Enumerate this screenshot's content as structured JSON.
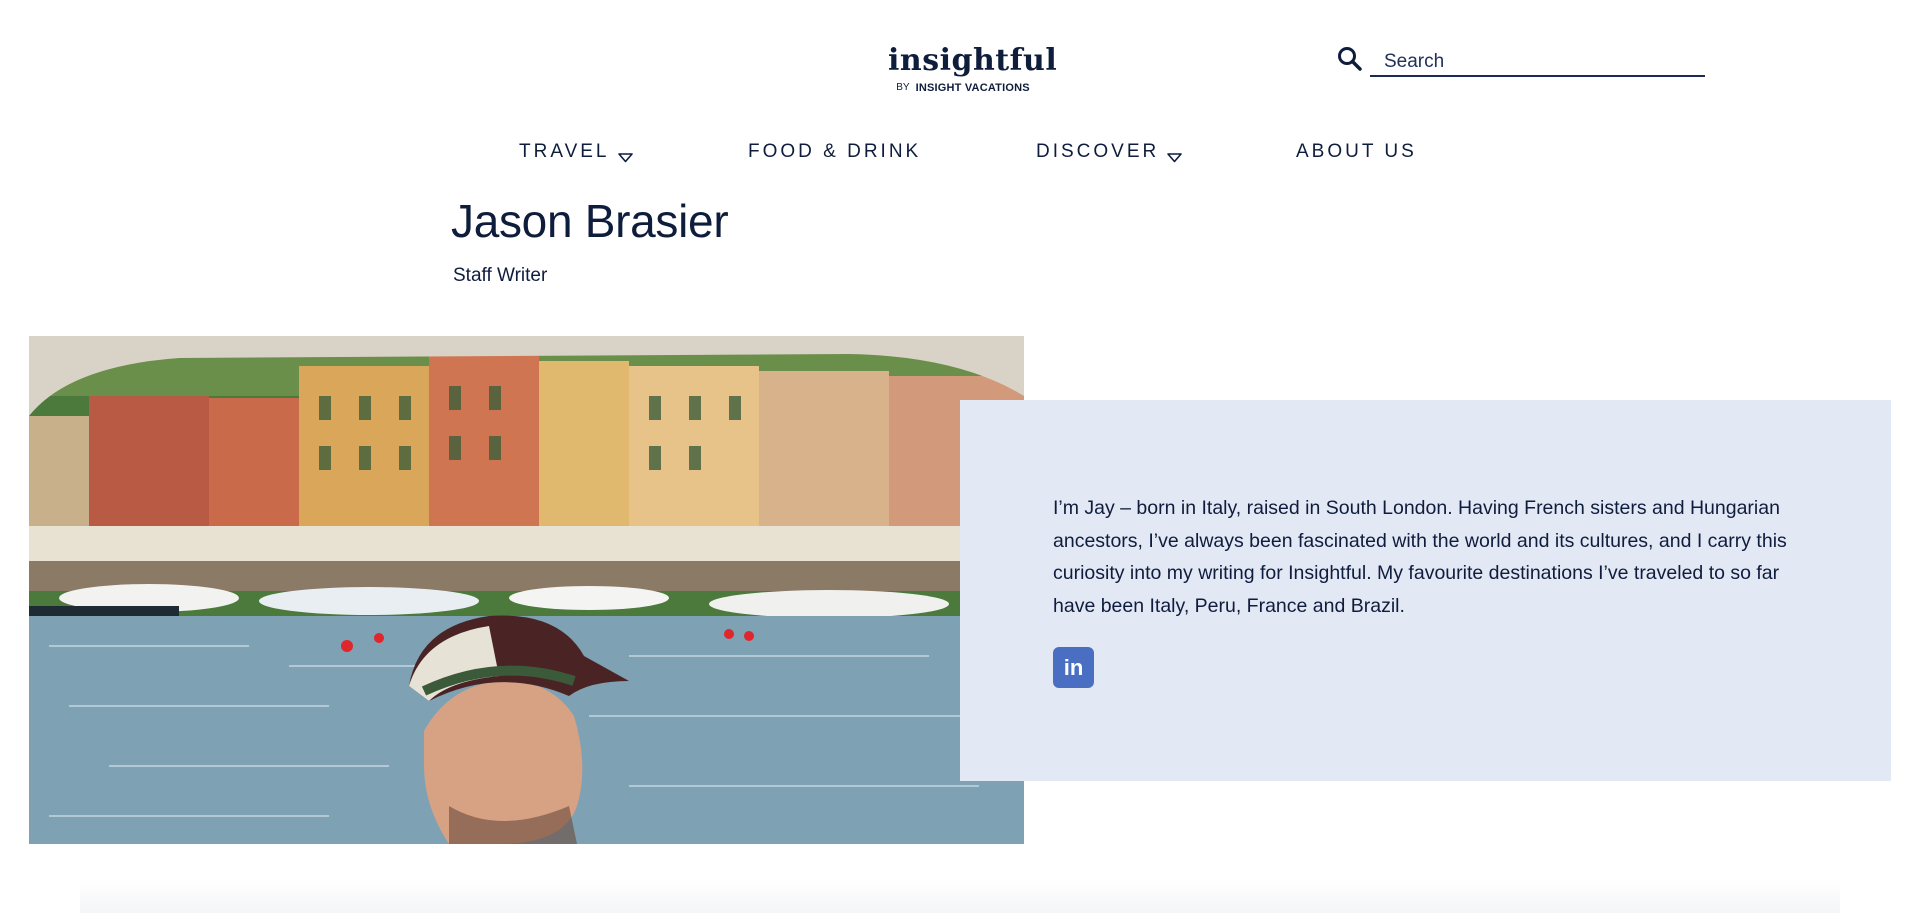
{
  "header": {
    "logo": {
      "wordmark": "insightful",
      "by": "BY",
      "brand": "INSIGHT VACATIONS"
    },
    "search": {
      "icon": "search-icon",
      "placeholder": "Search"
    }
  },
  "nav": {
    "items": [
      {
        "label": "TRAVEL",
        "has_dropdown": true
      },
      {
        "label": "FOOD & DRINK",
        "has_dropdown": false
      },
      {
        "label": "DISCOVER",
        "has_dropdown": true
      },
      {
        "label": "ABOUT US",
        "has_dropdown": false
      }
    ]
  },
  "author": {
    "name": "Jason Brasier",
    "role": "Staff Writer",
    "bio": "I’m Jay – born in Italy, raised in South London. Having French sisters and Hungarian ancestors, I’ve always been fascinated with the world and its cultures, and I carry this curiosity into my writing for Insightful. My favourite destinations I’ve traveled to so far have been Italy, Peru, France and Brazil.",
    "social": {
      "linkedin_icon": "linkedin-icon",
      "linkedin_text": "in"
    }
  },
  "colors": {
    "navy": "#0f1d3d",
    "panel": "#e3e8f5",
    "linkedin": "#4a6fc2"
  }
}
